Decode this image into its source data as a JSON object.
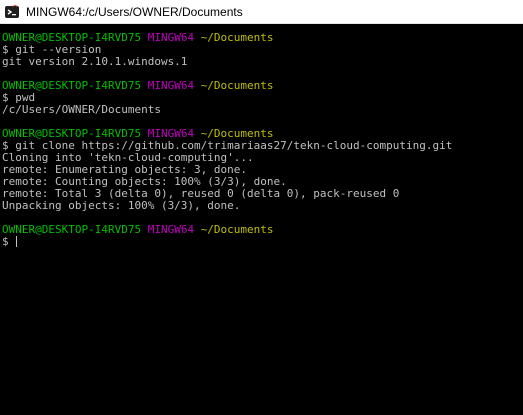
{
  "window": {
    "title": "MINGW64:/c/Users/OWNER/Documents",
    "icon": "git-bash-icon"
  },
  "colors": {
    "background": "#000000",
    "text": "#c0c0c0",
    "user_host": "#00bf00",
    "system": "#bf00bf",
    "path": "#bfbf00"
  },
  "prompt": {
    "user_host": "OWNER@DESKTOP-I4RVD75",
    "system": "MINGW64",
    "symbol": "$"
  },
  "session": [
    {
      "cwd": "~/Documents",
      "command": "git --version",
      "output": [
        "git version 2.10.1.windows.1"
      ]
    },
    {
      "cwd": "~/Documents",
      "command": "pwd",
      "output": [
        "/c/Users/OWNER/Documents"
      ]
    },
    {
      "cwd": "~/Documents",
      "command": "git clone https://github.com/trimariaas27/tekn-cloud-computing.git",
      "output": [
        "Cloning into 'tekn-cloud-computing'...",
        "remote: Enumerating objects: 3, done.",
        "remote: Counting objects: 100% (3/3), done.",
        "remote: Total 3 (delta 0), reused 0 (delta 0), pack-reused 0",
        "Unpacking objects: 100% (3/3), done."
      ]
    },
    {
      "cwd": "~/Documents",
      "command": "",
      "output": []
    }
  ]
}
